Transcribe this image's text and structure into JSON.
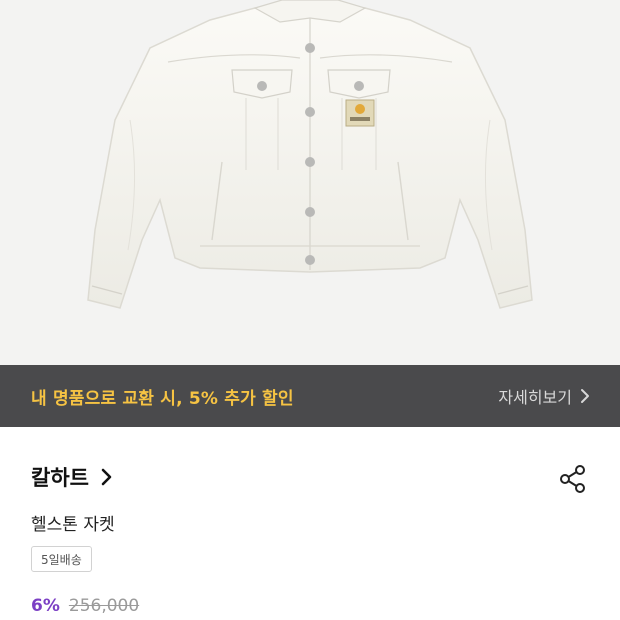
{
  "product_image": {
    "alt_icon": "denim-jacket-image"
  },
  "promo": {
    "text": "내 명품으로 교환 시, 5% 추가 할인",
    "link_label": "자세히보기",
    "bg": "#4a4a4c",
    "accent": "#f6c343"
  },
  "brand": {
    "name": "칼하트"
  },
  "product": {
    "name": "헬스톤 자켓",
    "shipping_badge": "5일배송",
    "discount": "6%",
    "original_price": "256,000"
  },
  "colors": {
    "discount": "#7b3fc4"
  }
}
